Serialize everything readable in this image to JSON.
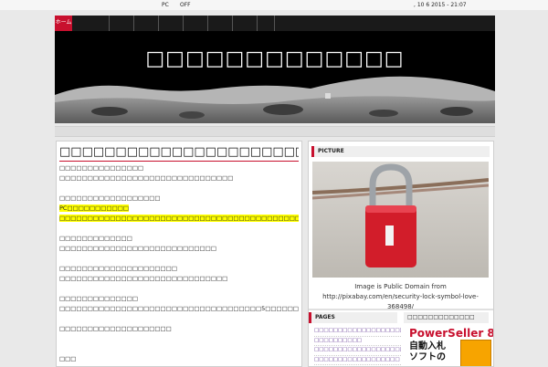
{
  "topbar": {
    "left_label": "PC",
    "toggle_label": "OFF",
    "datetime": ", 10 6   2015 - 21:07"
  },
  "nav": {
    "home_label": "ホーム"
  },
  "header": {
    "site_title": "□□□□□□□□□□□□□"
  },
  "post": {
    "title": "□□□□□□□□□□□□□□□□□□□□□□□□□",
    "lines": [
      "□□□□□□□□□□□□□□□",
      "□□□□□□□□□□□□□□□□□□□□□□□□□□□□□□□",
      "",
      "□□□□□□□□□□□□□□□□□□",
      "PC□□□□□□□□□□□",
      "□□□□□□□□□□□□□□□□□□□□□□□□□□□□□□□□□□□□□□□□□□□□□□□",
      "",
      "□□□□□□□□□□□□□",
      "□□□□□□□□□□□□□□□□□□□□□□□□□□□□",
      "",
      "□□□□□□□□□□□□□□□□□□□□□",
      "□□□□□□□□□□□□□□□□□□□□□□□□□□□□□□",
      "",
      "□□□□□□□□□□□□□□",
      "□□□□□□□□□□□□□□□□□□□□□□□□□□□□□□□□□□□□5□□□□□□",
      "",
      "□□□□□□□□□□□□□□□□□□□□",
      "",
      "",
      "□□□"
    ]
  },
  "sidebar": {
    "picture_heading": "PICTURE",
    "caption_line1": "Image is Public Domain from",
    "caption_line2": "http://pixabay.com/en/security-lock-symbol-love-368498/",
    "pages_heading": "PAGES",
    "pages": [
      "□□□□□□□□□□□□□□□□□□□",
      "□□□□□□□□□□",
      "□□□□□□□□□□□□□□□□□□□",
      "□□□□□□□□□□□□□□□□□□"
    ],
    "ad_heading": "□□□□□□□□□□□□□",
    "ad_title": "PowerSeller 8",
    "ad_line1": "自動入札",
    "ad_line2": "ソフトの"
  },
  "colors": {
    "accent": "#c8102e",
    "nav_bg": "#1a1a1a",
    "highlight": "#ffff00"
  }
}
